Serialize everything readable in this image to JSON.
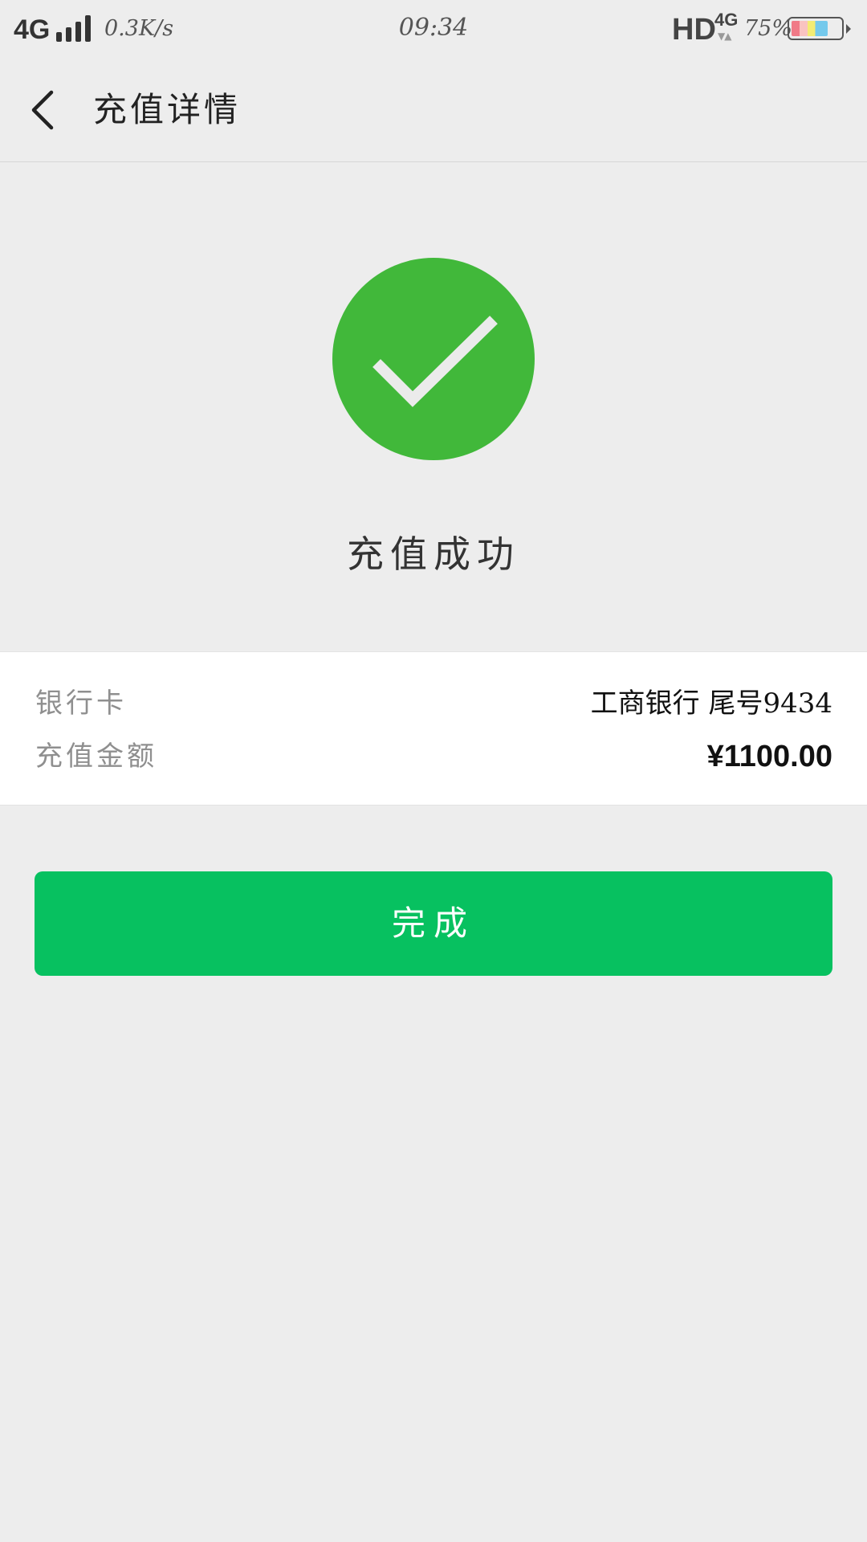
{
  "status_bar": {
    "network": "4G",
    "speed": "0.3K/s",
    "time": "09:34",
    "hd": "HD",
    "network_secondary": "4G",
    "battery_percent": "75%",
    "battery_level": 0.75
  },
  "nav": {
    "back_icon": "chevron-left-icon",
    "title": "充值详情"
  },
  "result": {
    "icon": "check-circle-icon",
    "icon_color": "#41b83a",
    "title": "充值成功"
  },
  "details": [
    {
      "label": "银行卡",
      "value": "工商银行 尾号9434"
    },
    {
      "label": "充值金额",
      "value": "¥1100.00"
    }
  ],
  "actions": {
    "done_label": "完成",
    "done_color": "#07c160"
  }
}
